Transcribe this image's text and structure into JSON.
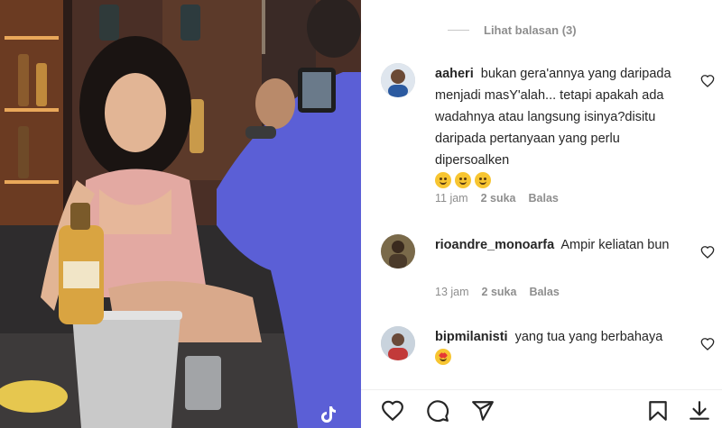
{
  "post": {
    "media": {
      "watermark_icon": "tiktok-icon"
    }
  },
  "view_replies": {
    "label": "Lihat balasan (3)"
  },
  "comments": [
    {
      "username": "aaheri",
      "text": "bukan gera'annya yang daripada menjadi masY'alah... tetapi apakah ada wadahnya atau langsung isinya?disitu daripada pertanyaan yang perlu dipersoalken",
      "emojis": [
        "crying-laughing-face",
        "smirk-face",
        "smiling-face"
      ],
      "time": "11 jam",
      "likes": "2 suka",
      "reply": "Balas"
    },
    {
      "username": "rioandre_monoarfa",
      "text": "Ampir keliatan bun",
      "time": "13 jam",
      "likes": "2 suka",
      "reply": "Balas"
    },
    {
      "username": "bipmilanisti",
      "text": "yang tua yang berbahaya",
      "emojis": [
        "star-struck-face"
      ]
    }
  ],
  "actions": {
    "like_icon": "heart-icon",
    "comment_icon": "comment-icon",
    "share_icon": "send-icon",
    "save_icon": "bookmark-icon",
    "download_icon": "download-icon"
  },
  "colors": {
    "text": "#262626",
    "muted": "#8e8e8e",
    "emoji": "#f7c531"
  }
}
